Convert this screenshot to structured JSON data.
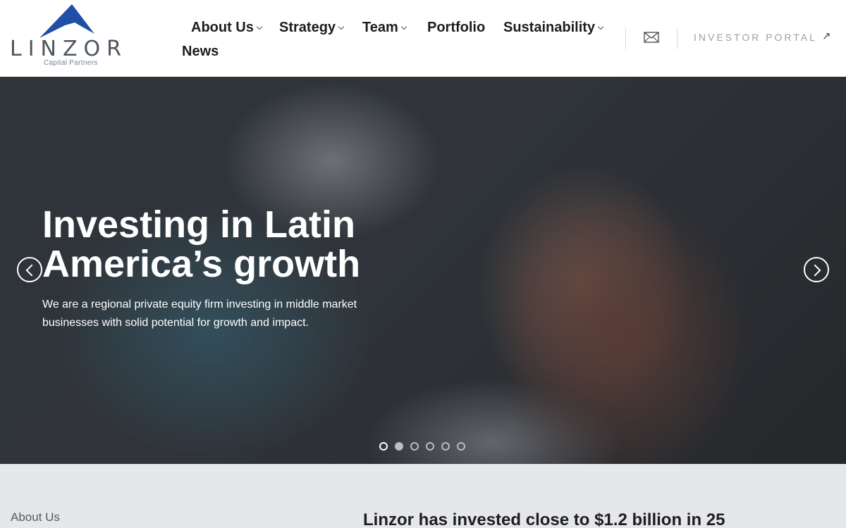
{
  "brand": {
    "name": "LINZOR",
    "subtitle": "Capital Partners",
    "accent": "#1f4fa8"
  },
  "nav": {
    "items": [
      {
        "label": "About Us",
        "has_dropdown": true
      },
      {
        "label": "Strategy",
        "has_dropdown": true
      },
      {
        "label": "Team",
        "has_dropdown": true
      },
      {
        "label": "Portfolio",
        "has_dropdown": false
      },
      {
        "label": "Sustainability",
        "has_dropdown": true
      },
      {
        "label": "News",
        "has_dropdown": false
      }
    ],
    "mail_icon": "mail-icon",
    "portal_label": "INVESTOR PORTAL",
    "portal_icon": "external-link-arrow-icon",
    "portal_arrow": "↗"
  },
  "hero": {
    "title": "Investing in Latin America’s growth",
    "description": "We are a regional private equity firm investing in middle market businesses with solid potential for growth and impact.",
    "slide_count": 6,
    "active_slide": 1,
    "prev_icon": "chevron-left-icon",
    "next_icon": "chevron-right-icon"
  },
  "lower": {
    "label": "About Us",
    "heading": "Linzor has invested close to $1.2 billion in 25"
  }
}
